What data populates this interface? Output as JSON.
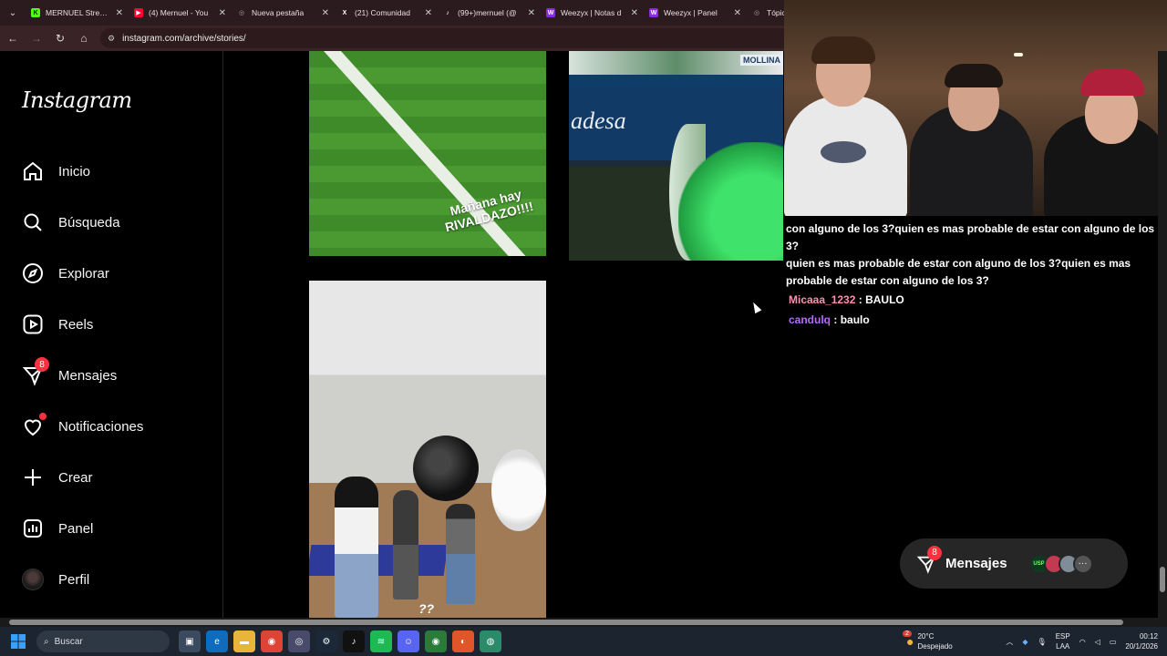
{
  "browser": {
    "tabs": [
      {
        "title": "MERNUEL Stream",
        "fav_color": "#53fc18",
        "fav_glyph": "K"
      },
      {
        "title": "(4) Mernuel - You",
        "fav_color": "#ff0033",
        "fav_glyph": "▶"
      },
      {
        "title": "Nueva pestaña",
        "fav_color": "#9aa0a6",
        "fav_glyph": "◎"
      },
      {
        "title": "(21) Comunidad",
        "fav_color": "#000000",
        "fav_glyph": "X"
      },
      {
        "title": "(99+)mernuel (@",
        "fav_color": "#111111",
        "fav_glyph": "♪"
      },
      {
        "title": "Weezyx | Notas d",
        "fav_color": "#8a2be2",
        "fav_glyph": "W"
      },
      {
        "title": "Weezyx | Panel",
        "fav_color": "#8a2be2",
        "fav_glyph": "W"
      },
      {
        "title": "Tópicos d",
        "fav_color": "#9aa0a6",
        "fav_glyph": "◎"
      }
    ],
    "url": "instagram.com/archive/stories/"
  },
  "sidebar": {
    "logo": "Instagram",
    "items": [
      {
        "label": "Inicio",
        "icon": "home-icon"
      },
      {
        "label": "Búsqueda",
        "icon": "search-icon"
      },
      {
        "label": "Explorar",
        "icon": "compass-icon"
      },
      {
        "label": "Reels",
        "icon": "reels-icon"
      },
      {
        "label": "Mensajes",
        "icon": "messenger-icon",
        "badge": "8"
      },
      {
        "label": "Notificaciones",
        "icon": "heart-icon",
        "dot": true
      },
      {
        "label": "Crear",
        "icon": "plus-icon"
      },
      {
        "label": "Panel",
        "icon": "dashboard-icon"
      },
      {
        "label": "Perfil",
        "icon": "avatar"
      }
    ]
  },
  "stories": {
    "story1_caption_line1": "Mañana hay",
    "story1_caption_line2": "RIVALDAZO!!!!",
    "story2_brand": "adesa",
    "story2_banner": "MOLLINA",
    "story3_caption": "??"
  },
  "chat": {
    "message_lines": [
      "con alguno de los 3?quien es mas probable de estar con alguno de los 3?",
      "quien es mas probable de estar con alguno de los 3?quien es mas",
      "probable de estar con alguno de los 3?"
    ],
    "entries": [
      {
        "user": "Micaaa_1232",
        "text": "BAULO",
        "color": "#ff8fb0"
      },
      {
        "user": "candulq",
        "text": "baulo",
        "color": "#b36bff"
      }
    ]
  },
  "messages_pill": {
    "label": "Mensajes",
    "badge": "8",
    "more": "···"
  },
  "taskbar": {
    "search_placeholder": "Buscar",
    "weather_temp": "20°C",
    "weather_desc": "Despejado",
    "weather_badge": "2",
    "lang_top": "ESP",
    "lang_bottom": "LAA",
    "time": "00:12",
    "date": "20/1/2026"
  }
}
